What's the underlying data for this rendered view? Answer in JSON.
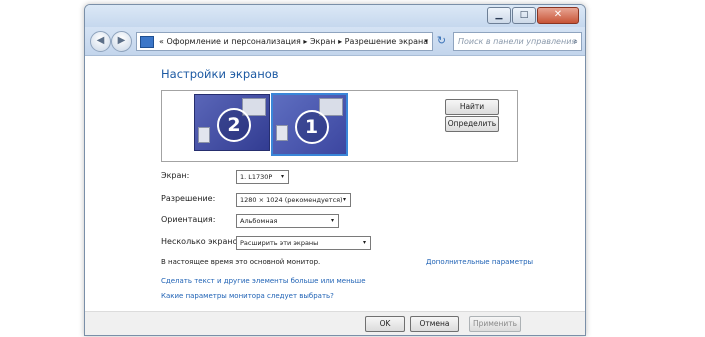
{
  "window": {
    "title_buttons": {
      "minimize_icon": "minimize-icon",
      "maximize_icon": "maximize-icon",
      "close_icon": "close-icon"
    },
    "caption_glyphs": {
      "minimize": "▁",
      "maximize": "□",
      "close": "✕"
    }
  },
  "navigation": {
    "back_glyph": "◀",
    "forward_glyph": "▶",
    "breadcrumb": "« Оформление и персонализация ▸ Экран ▸ Разрешение экрана",
    "dropdown_glyph": "▾",
    "refresh_glyph": "↻",
    "search_placeholder": "Поиск в панели управления",
    "search_glyph": "⌕"
  },
  "page": {
    "heading": "Настройки экранов"
  },
  "monitors": [
    {
      "number": "2",
      "selected": false
    },
    {
      "number": "1",
      "selected": true
    }
  ],
  "preview_buttons": {
    "detect": "Найти",
    "identify": "Определить"
  },
  "settings": {
    "display": {
      "label": "Экран:",
      "value": "1. L1730P"
    },
    "resolution": {
      "label": "Разрешение:",
      "value": "1280 × 1024 (рекомендуется)"
    },
    "orientation": {
      "label": "Ориентация:",
      "value": "Альбомная"
    },
    "multiple_displays": {
      "label": "Несколько экранов:",
      "value": "Расширить эти экраны"
    }
  },
  "main_monitor_note": "В настоящее время это основной монитор.",
  "advanced_settings_link": "Дополнительные параметры",
  "links": {
    "text_size": "Сделать текст и другие элементы больше или меньше",
    "which_settings": "Какие параметры монитора следует выбрать?"
  },
  "footer": {
    "ok": "OK",
    "cancel": "Отмена",
    "apply": "Применить"
  },
  "colors": {
    "heading": "#1d5aa3",
    "link": "#1f62b5",
    "monitor_fill": "#4a56b0",
    "selected_border": "#3a86d8"
  }
}
